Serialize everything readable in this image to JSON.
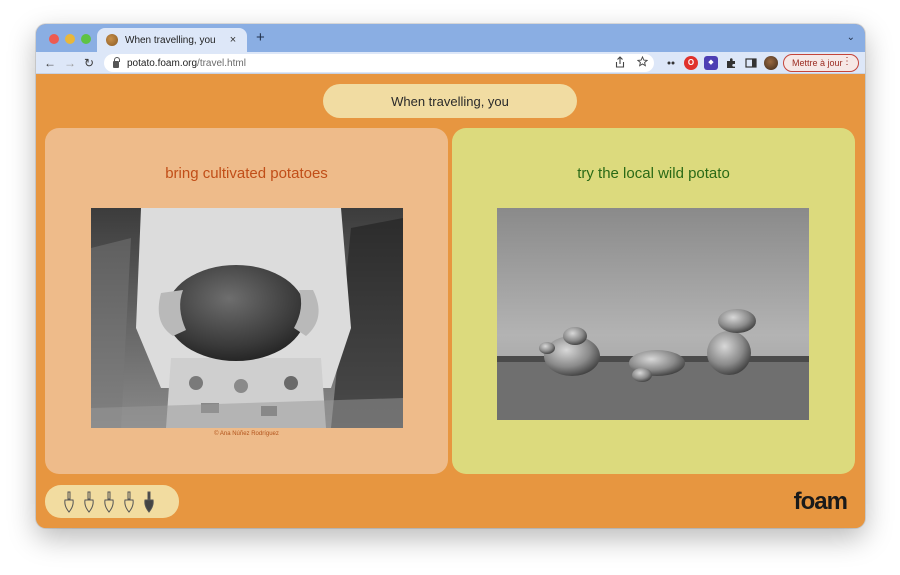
{
  "browser": {
    "tab": {
      "title": "When travelling, you",
      "close_glyph": "×"
    },
    "new_tab_glyph": "+",
    "tab_menu_glyph": "⌄",
    "nav": {
      "back_glyph": "←",
      "forward_glyph": "→",
      "reload_glyph": "↻"
    },
    "url": {
      "domain": "potato.foam.org",
      "path": "/travel.html"
    },
    "update_button_label": "Mettre à jour",
    "update_menu_glyph": "⋮",
    "omnibox_icons": [
      "share-icon",
      "star-icon"
    ],
    "extension_icons": [
      "extension-dots-icon",
      "opera-icon",
      "extension-badge-icon",
      "puzzle-icon",
      "sidebar-icon",
      "profile-avatar"
    ]
  },
  "page": {
    "question": "When travelling, you",
    "options": [
      {
        "label": "bring cultivated potatoes",
        "photo_description": "child holding a large cultivated potato",
        "credit": "© Ana Núñez Rodríguez",
        "bg_color": "#eebb8a",
        "label_color": "#c14e18"
      },
      {
        "label": "try the local wild potato",
        "photo_description": "three small wild potatoes on a table",
        "bg_color": "#dcda7d",
        "label_color": "#2a6a16"
      }
    ],
    "progress": {
      "total": 5,
      "completed": 4
    },
    "logo": "foam",
    "background_color": "#e79640"
  }
}
